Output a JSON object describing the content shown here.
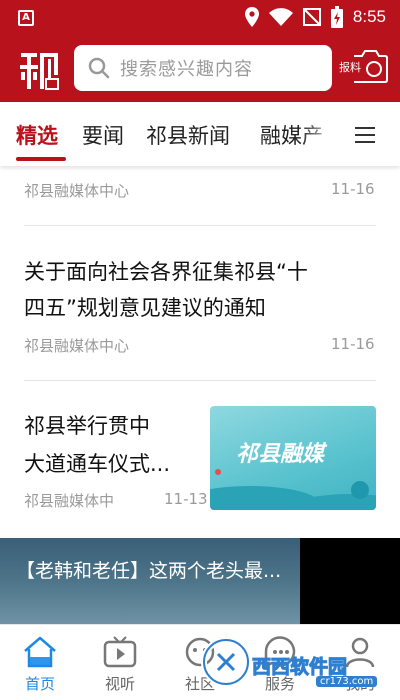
{
  "status_bar": {
    "time": "8:55",
    "icons": [
      "app-icon",
      "location-icon",
      "wifi-icon",
      "signal-off-icon",
      "battery-icon"
    ]
  },
  "header": {
    "logo_name": "qi-xian-logo",
    "search_placeholder": "搜索感兴趣内容",
    "report_label": "报料",
    "brand_color": "#b8121c"
  },
  "tabs": {
    "items": [
      {
        "label": "精选",
        "active": true
      },
      {
        "label": "要闻",
        "active": false
      },
      {
        "label": "祁县新闻",
        "active": false
      },
      {
        "label": "融媒产",
        "active": false
      }
    ],
    "menu_icon": "menu-icon"
  },
  "feed": {
    "items": [
      {
        "source": "祁县融媒体中心",
        "date": "11-16"
      },
      {
        "title_line1": "关于面向社会各界征集祁县“十",
        "title_line2": "四五”规划意见建议的通知",
        "source": "祁县融媒体中心",
        "date": "11-16"
      },
      {
        "title_line1": "祁县举行贯中",
        "title_line2": "大道通车仪式...",
        "source": "祁县融媒体中",
        "date": "11-13",
        "thumb_text": "祁县融媒"
      }
    ]
  },
  "video_banner": {
    "title": "【老韩和老任】这两个老头最..."
  },
  "bottom_nav": {
    "items": [
      {
        "label": "首页",
        "icon": "home-icon",
        "active": true
      },
      {
        "label": "视听",
        "icon": "tv-icon",
        "active": false
      },
      {
        "label": "社区",
        "icon": "community-icon",
        "active": false
      },
      {
        "label": "服务",
        "icon": "service-icon",
        "active": false
      },
      {
        "label": "我的",
        "icon": "profile-icon",
        "active": false
      }
    ],
    "active_color": "#1e88e5"
  },
  "watermark": {
    "text": "西西软件园",
    "sub": "cr173.com"
  }
}
